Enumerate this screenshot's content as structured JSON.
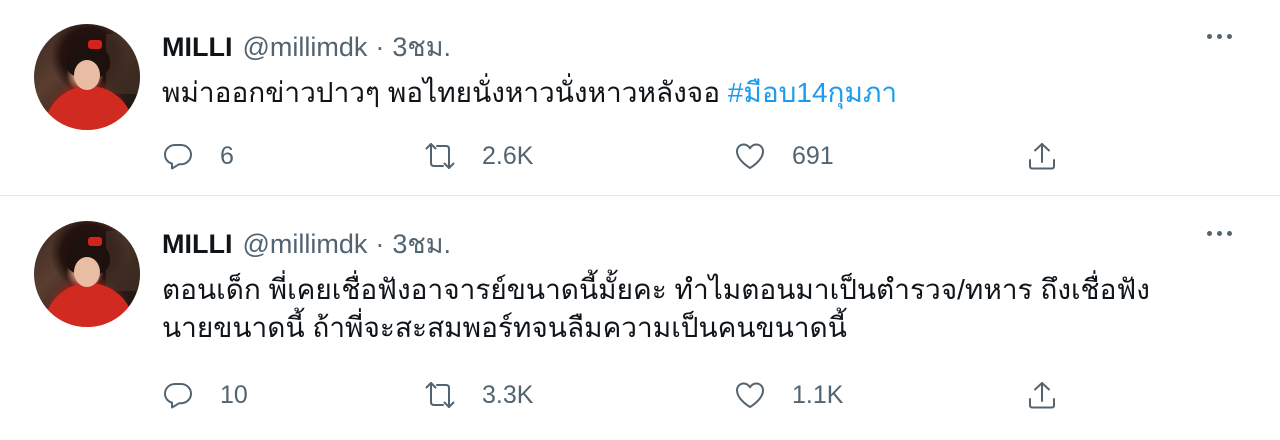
{
  "tweets": [
    {
      "name": "MILLI",
      "handle": "@millimdk",
      "separator": "·",
      "time": "3ชม.",
      "text": "พม่าออกข่าวปาวๆ พอไทยนั่งหาวนั่งหาวหลังจอ ",
      "hashtag": "#มือบ14กุมภา",
      "replies": "6",
      "retweets": "2.6K",
      "likes": "691"
    },
    {
      "name": "MILLI",
      "handle": "@millimdk",
      "separator": "·",
      "time": "3ชม.",
      "text_line1": "ตอนเด็ก พี่เคยเชื่อฟังอาจารย์ขนาดนี้มั้ยคะ ทำไมตอนมาเป็นตำรวจ/ทหาร ถึงเชื่อฟัง",
      "text_line2": "นายขนาดนี้ ถ้าพี่จะสะสมพอร์ทจนลืมความเป็นคนขนาดนี้",
      "replies": "10",
      "retweets": "3.3K",
      "likes": "1.1K"
    }
  ],
  "icons": {
    "reply": "reply-icon",
    "retweet": "retweet-icon",
    "like": "like-icon",
    "share": "share-icon",
    "more": "more-icon"
  },
  "colors": {
    "hashtag": "#1d9bf0",
    "secondary_text": "#536471",
    "divider": "#e6e9eb"
  }
}
